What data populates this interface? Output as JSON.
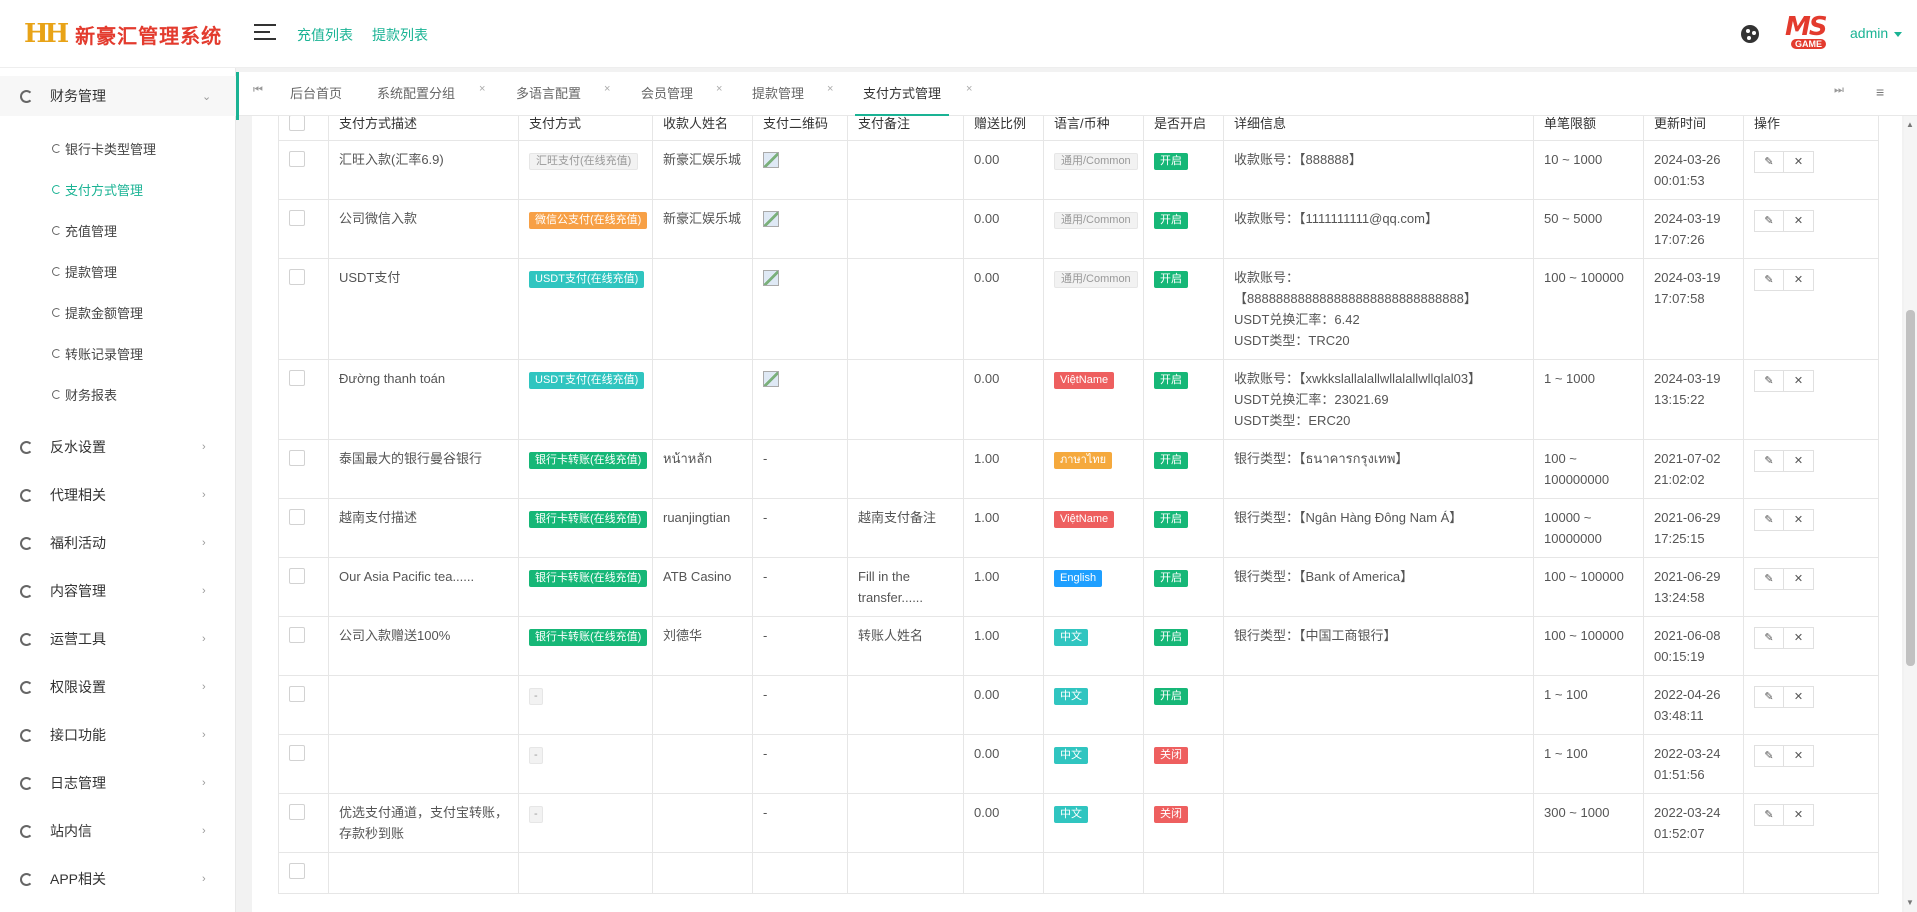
{
  "header": {
    "logo_mark": "HH",
    "logo_text": "新豪汇管理系统",
    "links": [
      "充值列表",
      "提款列表"
    ],
    "ms_logo": "MS",
    "ms_logo_sub": "GAME",
    "user": "admin"
  },
  "sidebar": {
    "groups": [
      {
        "label": "财务管理",
        "arrow": "⌄"
      },
      {
        "label": "反水设置",
        "arrow": "›"
      },
      {
        "label": "代理相关",
        "arrow": "›"
      },
      {
        "label": "福利活动",
        "arrow": "›"
      },
      {
        "label": "内容管理",
        "arrow": "›"
      },
      {
        "label": "运营工具",
        "arrow": "›"
      },
      {
        "label": "权限设置",
        "arrow": "›"
      },
      {
        "label": "接口功能",
        "arrow": "›"
      },
      {
        "label": "日志管理",
        "arrow": "›"
      },
      {
        "label": "站内信",
        "arrow": "›"
      },
      {
        "label": "APP相关",
        "arrow": "›"
      }
    ],
    "sub_items": [
      "银行卡类型管理",
      "支付方式管理",
      "充值管理",
      "提款管理",
      "提款金额管理",
      "转账记录管理",
      "财务报表"
    ]
  },
  "tabs": {
    "first_icon": "⏮",
    "last_icon": "⏭",
    "menu_icon": "≡",
    "close": "×",
    "items": [
      "后台首页",
      "系统配置分组",
      "多语言配置",
      "会员管理",
      "提款管理",
      "支付方式管理"
    ]
  },
  "table": {
    "headers": [
      "",
      "支付方式描述",
      "支付方式",
      "收款人姓名",
      "支付二维码",
      "支付备注",
      "赠送比例",
      "语言/币种",
      "是否开启",
      "详细信息",
      "单笔限额",
      "更新时间",
      "操作"
    ],
    "rows": [
      {
        "desc": "汇旺入款(汇率6.9)",
        "method": "汇旺支付(在线充值)",
        "payee": "新豪汇娱乐城",
        "remark": "",
        "ratio": "0.00",
        "lang": "通用/Common",
        "status": "开启",
        "details": [
          "收款账号：【888888】"
        ],
        "limit": "10 ~ 1000",
        "date": "2024-03-26",
        "time": "00:01:53"
      },
      {
        "desc": "公司微信入款",
        "method": "微信公支付(在线充值)",
        "payee": "新豪汇娱乐城",
        "remark": "",
        "ratio": "0.00",
        "lang": "通用/Common",
        "status": "开启",
        "details": [
          "收款账号：【1111111111@qq.com】"
        ],
        "limit": "50 ~ 5000",
        "date": "2024-03-19",
        "time": "17:07:26"
      },
      {
        "desc": "USDT支付",
        "method": "USDT支付(在线充值)",
        "payee": "",
        "remark": "",
        "ratio": "0.00",
        "lang": "通用/Common",
        "status": "开启",
        "details": [
          "收款账号：",
          "【888888888888888888888888888888】",
          "USDT兑换汇率：6.42",
          "USDT类型：TRC20"
        ],
        "limit": "100 ~ 100000",
        "date": "2024-03-19",
        "time": "17:07:58"
      },
      {
        "desc": "Đường thanh toán",
        "method": "USDT支付(在线充值)",
        "payee": "",
        "remark": "",
        "ratio": "0.00",
        "lang": "ViệtName",
        "status": "开启",
        "details": [
          "收款账号：【xwkkslallalallwllalallwllqlal03】",
          "USDT兑换汇率：23021.69",
          "USDT类型：ERC20"
        ],
        "limit": "1 ~ 1000",
        "date": "2024-03-19",
        "time": "13:15:22"
      },
      {
        "desc": "泰国最大的银行曼谷银行",
        "method": "银行卡转账(在线充值)",
        "payee": "หน้าหลัก",
        "qr": "-",
        "remark": "",
        "ratio": "1.00",
        "lang": "ภาษาไทย",
        "status": "开启",
        "details": [
          "银行类型：【ธนาคารกรุงเทพ】"
        ],
        "limit": "100 ~ 100000000",
        "date": "2021-07-02",
        "time": "21:02:02"
      },
      {
        "desc": "越南支付描述",
        "method": "银行卡转账(在线充值)",
        "payee": "ruanjingtian",
        "qr": "-",
        "remark": "越南支付备注",
        "ratio": "1.00",
        "lang": "ViệtName",
        "status": "开启",
        "details": [
          "银行类型：【Ngân Hàng Đông Nam Á】"
        ],
        "limit": "10000 ~ 10000000",
        "date": "2021-06-29",
        "time": "17:25:15"
      },
      {
        "desc": "Our Asia Pacific tea......",
        "method": "银行卡转账(在线充值)",
        "payee": "ATB Casino",
        "qr": "-",
        "remark": "Fill in the transfer......",
        "ratio": "1.00",
        "lang": "English",
        "status": "开启",
        "details": [
          "银行类型：【Bank of America】"
        ],
        "limit": "100 ~ 100000",
        "date": "2021-06-29",
        "time": "13:24:58"
      },
      {
        "desc": "公司入款赠送100%",
        "method": "银行卡转账(在线充值)",
        "payee": "刘德华",
        "qr": "-",
        "remark": "转账人姓名",
        "ratio": "1.00",
        "lang": "中文",
        "status": "开启",
        "details": [
          "银行类型：【中国工商银行】"
        ],
        "limit": "100 ~ 100000",
        "date": "2021-06-08",
        "time": "00:15:19"
      },
      {
        "desc": "",
        "method": "-",
        "payee": "",
        "qr": "-",
        "remark": "",
        "ratio": "0.00",
        "lang": "中文",
        "status": "开启",
        "details": [],
        "limit": "1 ~ 100",
        "date": "2022-04-26",
        "time": "03:48:11"
      },
      {
        "desc": "",
        "method": "-",
        "payee": "",
        "qr": "-",
        "remark": "",
        "ratio": "0.00",
        "lang": "中文",
        "status": "关闭",
        "details": [],
        "limit": "1 ~ 100",
        "date": "2022-03-24",
        "time": "01:51:56"
      },
      {
        "desc": "优选支付通道，支付宝转账，存款秒到账",
        "method": "-",
        "payee": "",
        "qr": "-",
        "remark": "",
        "ratio": "0.00",
        "lang": "中文",
        "status": "关闭",
        "details": [],
        "limit": "300 ~ 1000",
        "date": "2022-03-24",
        "time": "01:52:07"
      }
    ],
    "edit_icon": "✎",
    "delete_icon": "✕"
  },
  "colors": {
    "accent": "#1ab394",
    "open": "#16b777",
    "closed": "#ee5f5f",
    "orange": "#f7a046",
    "teal": "#30c5c0",
    "blue": "#1e9fff"
  },
  "scroll": {
    "up": "▲",
    "down": "▼"
  }
}
